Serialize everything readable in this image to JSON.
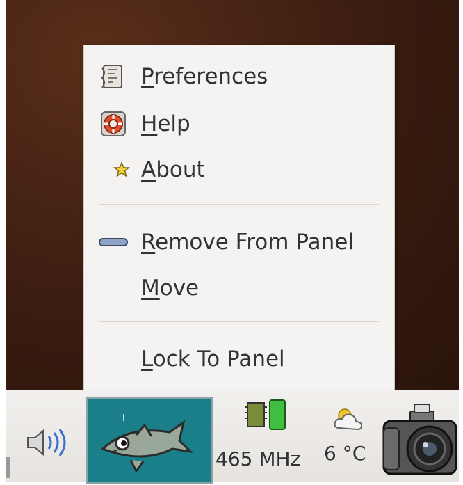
{
  "menu": {
    "items": [
      {
        "label": "Preferences",
        "mnemonic": "P",
        "rest": "references",
        "icon": "preferences-icon"
      },
      {
        "label": "Help",
        "mnemonic": "H",
        "rest": "elp",
        "icon": "help-lifebuoy-icon"
      },
      {
        "label": "About",
        "mnemonic": "A",
        "rest": "bout",
        "icon": "about-star-icon"
      },
      {
        "label": "Remove From Panel",
        "mnemonic": "R",
        "rest": "emove From Panel",
        "icon": "remove-icon"
      },
      {
        "label": "Move",
        "mnemonic": "M",
        "rest": "ove",
        "icon": ""
      },
      {
        "label": "Lock To Panel",
        "mnemonic": "L",
        "rest": "ock To Panel",
        "icon": ""
      }
    ]
  },
  "panel": {
    "cpu_frequency": "465 MHz",
    "temperature": "6 °C"
  },
  "colors": {
    "desktop": "#3a1c10",
    "menu_bg": "#f5f3f1",
    "fish_bg": "#1b7f8a"
  }
}
